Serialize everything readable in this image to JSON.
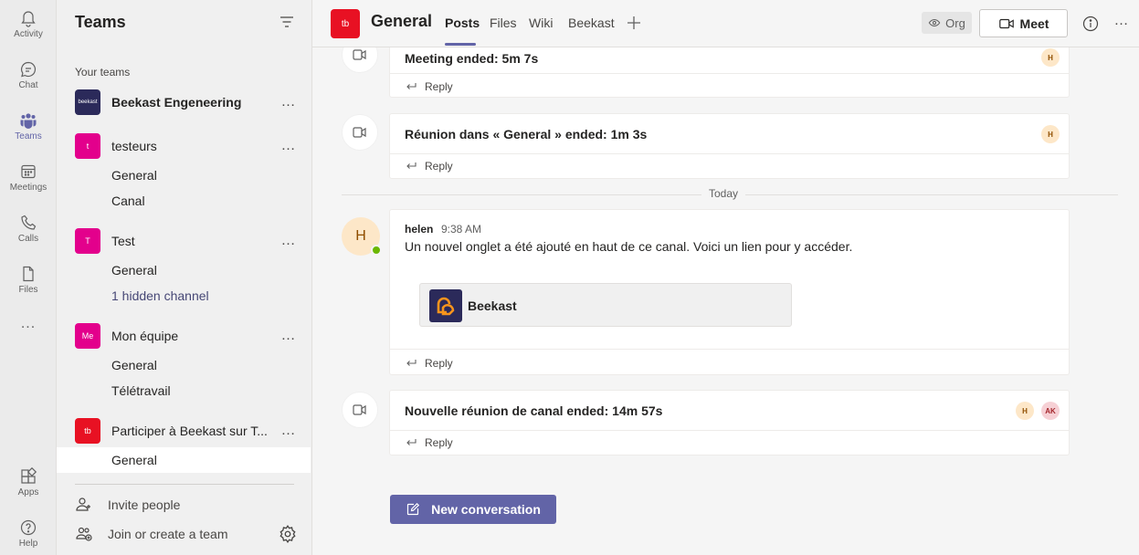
{
  "appbar": {
    "items": [
      {
        "label": "Activity",
        "icon": "bell-icon"
      },
      {
        "label": "Chat",
        "icon": "chat-icon"
      },
      {
        "label": "Teams",
        "icon": "teams-icon"
      },
      {
        "label": "Meetings",
        "icon": "calendar-icon"
      },
      {
        "label": "Calls",
        "icon": "phone-icon"
      },
      {
        "label": "Files",
        "icon": "file-icon"
      }
    ],
    "more": "...",
    "apps": "Apps",
    "help": "Help"
  },
  "sidebar": {
    "title": "Teams",
    "section_label": "Your teams",
    "teams": [
      {
        "name": "Beekast Engeneering",
        "avatar": "beekast",
        "color": "#2b2a5a",
        "channels": []
      },
      {
        "name": "testeurs",
        "avatar": "t",
        "color": "#e3008c",
        "channels": [
          "General",
          "Canal"
        ]
      },
      {
        "name": "Test",
        "avatar": "T",
        "color": "#e3008c",
        "channels": [
          "General",
          "1 hidden channel"
        ]
      },
      {
        "name": "Mon équipe",
        "avatar": "Me",
        "color": "#e3008c",
        "channels": [
          "General",
          "Télétravail"
        ]
      },
      {
        "name": "Participer à Beekast sur T...",
        "avatar": "tb",
        "color": "#e81123",
        "channels": [
          "General"
        ]
      }
    ],
    "more": "…",
    "invite_people": "Invite people",
    "join_create": "Join or create a team"
  },
  "header": {
    "avatar": "tb",
    "title": "General",
    "tabs": [
      "Posts",
      "Files",
      "Wiki",
      "Beekast"
    ],
    "active_tab": "Posts",
    "org_label": "Org",
    "meet_label": "Meet"
  },
  "feed": {
    "messages": [
      {
        "text": "Meeting ended: 5m 7s",
        "participants": [
          "H"
        ]
      },
      {
        "text": "Réunion dans « General » ended: 1m 3s",
        "participants": [
          "H"
        ]
      },
      {
        "text": "Nouvelle réunion de canal ended: 14m 57s",
        "participants": [
          "H",
          "AK"
        ]
      }
    ],
    "reply_label": "Reply",
    "divider": "Today",
    "post": {
      "author_initial": "H",
      "author": "helen",
      "time": "9:38 AM",
      "body": "Un nouvel onglet a été ajouté en haut de ce canal. Voici un lien pour y accéder.",
      "tab_card_name": "Beekast"
    },
    "new_conversation": "New conversation"
  },
  "colors": {
    "accent": "#6264a7",
    "team_pink": "#e3008c",
    "team_red": "#e81123",
    "presence_available": "#6bb700"
  }
}
